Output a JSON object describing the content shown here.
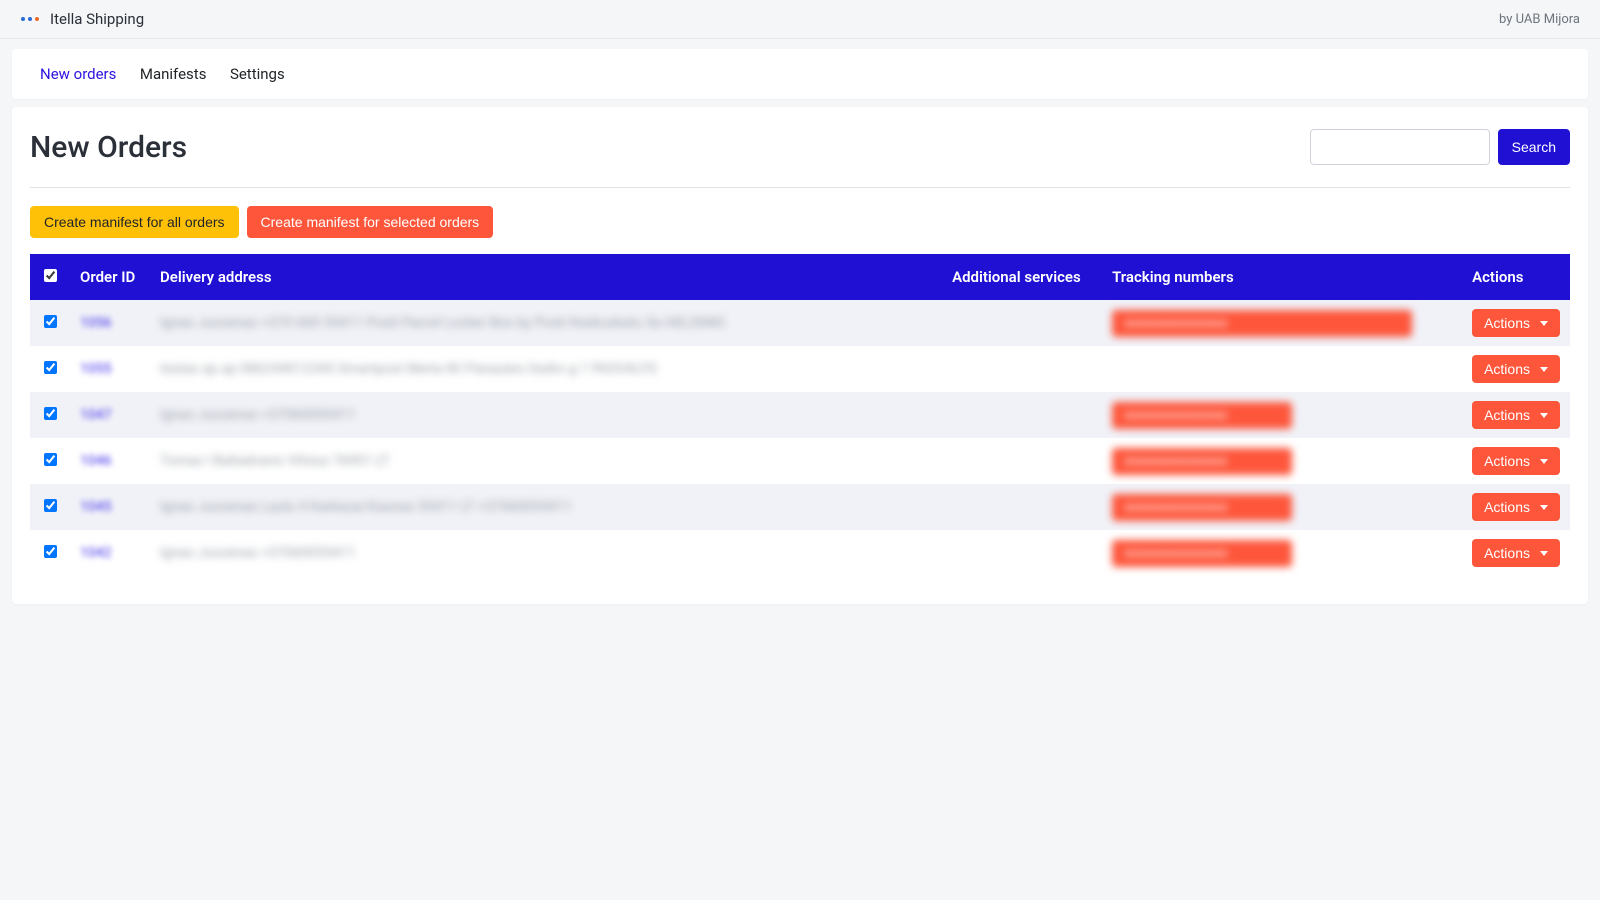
{
  "top": {
    "app_name": "Itella Shipping",
    "byline": "by UAB Mijora"
  },
  "nav": {
    "new_orders": "New orders",
    "manifests": "Manifests",
    "settings": "Settings"
  },
  "page": {
    "title": "New Orders",
    "search_button": "Search"
  },
  "toolbar": {
    "create_all": "Create manifest for all orders",
    "create_selected": "Create manifest for selected orders"
  },
  "table": {
    "headers": {
      "order_id": "Order ID",
      "delivery_address": "Delivery address",
      "additional_services": "Additional services",
      "tracking_numbers": "Tracking numbers",
      "actions": "Actions"
    },
    "action_label": "Actions",
    "rows": [
      {
        "order_id": "1056",
        "address": "Ignas Juozenas  +370 600 55411  Posti Parcel Locker Box by Posti Keskuskatu 5a HELSINKI",
        "tracking_class": "wide",
        "has_tracking": true
      },
      {
        "order_id": "1055",
        "address": "testas ap ap  086244012345  Smartpost Merla IKI Panautes Gedro g 1 PASVALYS",
        "tracking_class": "",
        "has_tracking": false
      },
      {
        "order_id": "1047",
        "address": "Ignas Juozenas  +37060055411",
        "tracking_class": "narrow",
        "has_tracking": true
      },
      {
        "order_id": "1046",
        "address": "Tomas I Baltadvario Vilnius 76901 LT",
        "tracking_class": "narrow",
        "has_tracking": true
      },
      {
        "order_id": "1045",
        "address": "Ignas Juozenas Laulu 4 Karkazai Kaunas 55411 LT +37060055411",
        "tracking_class": "narrow",
        "has_tracking": true
      },
      {
        "order_id": "1042",
        "address": "Ignas Juozenas  +37060055411",
        "tracking_class": "narrow",
        "has_tracking": true
      }
    ]
  }
}
